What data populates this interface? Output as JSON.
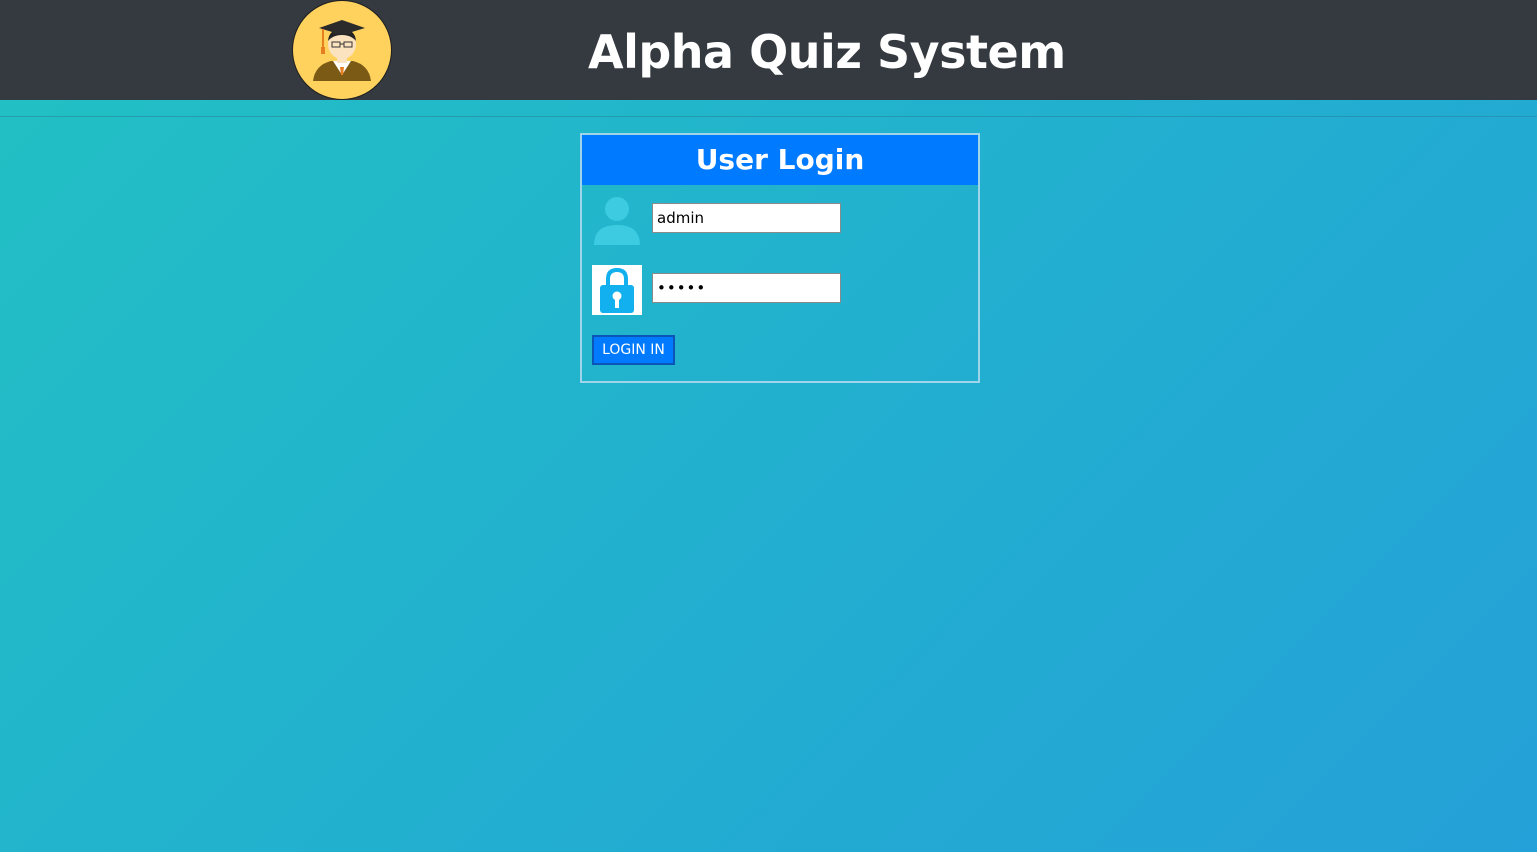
{
  "header": {
    "title": "Alpha Quiz System",
    "logo": "graduate-avatar-icon",
    "background": "#343a40"
  },
  "login": {
    "title": "User Login",
    "username": {
      "value": "admin",
      "icon": "user-icon"
    },
    "password": {
      "value": "admin",
      "icon": "lock-icon"
    },
    "submit_label": "LOGIN IN"
  },
  "colors": {
    "accent": "#007bff",
    "background_start": "#22c1c3",
    "background_end": "#24a1d8"
  }
}
